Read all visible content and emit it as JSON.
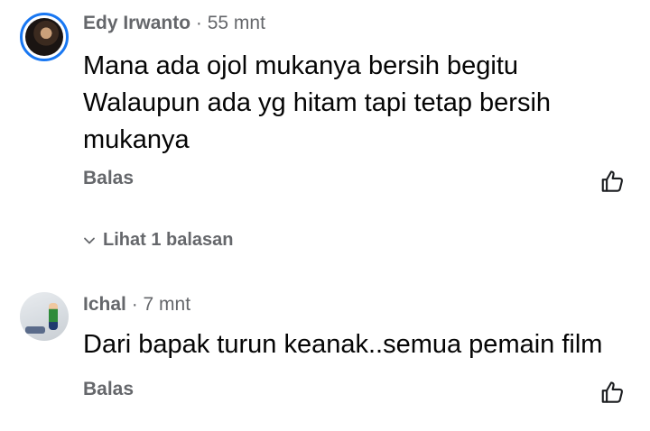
{
  "comments": [
    {
      "author": "Edy Irwanto",
      "separator": "·",
      "time": "55 mnt",
      "text": "Mana ada ojol mukanya bersih begitu\nWalaupun ada yg hitam tapi tetap bersih\nmukanya",
      "reply_label": "Balas",
      "view_replies_label": "Lihat 1 balasan",
      "avatar_icon": "profile-photo"
    },
    {
      "author": "Ichal",
      "separator": "·",
      "time": "7 mnt",
      "text": "Dari bapak turun keanak..semua pemain film",
      "reply_label": "Balas",
      "avatar_icon": "profile-photo"
    }
  ],
  "icons": {
    "like": "thumbs-up-icon",
    "expand": "chevron-down-icon"
  },
  "colors": {
    "avatar_ring": "#1877f2",
    "secondary_text": "#65676b",
    "primary_text": "#050505"
  }
}
